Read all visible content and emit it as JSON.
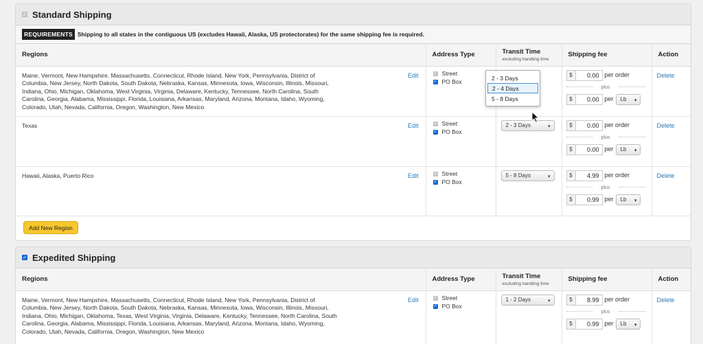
{
  "standard": {
    "title": "Standard Shipping",
    "requirements_badge": "REQUIREMENTS",
    "requirements_text": "Shipping to all states in the contiguous US (excludes Hawaii, Alaska, US protectorates) for the same shipping fee is required.",
    "add_region_label": "Add New Region",
    "rows": [
      {
        "regions": "Maine, Vermont, New Hampshire, Massachusetts, Connecticut, Rhode Island, New York, Pennsylvania, District of Columbia, New Jersey, North Dakota, South Dakota, Nebraska, Kansas, Minnesota, Iowa, Wisconsin, Illinois, Missouri, Indiana, Ohio, Michigan, Oklahoma, West Virginia, Virginia, Delaware, Kentucky, Tennessee, North Carolina, South Carolina, Georgia, Alabama, Mississippi, Florida, Louisiana, Arkansas, Maryland, Arizona, Montana, Idaho, Wyoming, Colorado, Utah, Nevada, California, Oregon, Washington, New Mexico",
        "transit": "2 - 4 Days",
        "per_order": "0.00",
        "per_unit": "0.00",
        "unit": "Lb"
      },
      {
        "regions": "Texas",
        "transit": "2 - 3 Days",
        "per_order": "0.00",
        "per_unit": "0.00",
        "unit": "Lb"
      },
      {
        "regions": "Hawaii, Alaska, Puerto Rico",
        "transit": "5 - 8 Days",
        "per_order": "4.99",
        "per_unit": "0.99",
        "unit": "Lb"
      }
    ]
  },
  "expedited": {
    "title": "Expedited Shipping",
    "rows": [
      {
        "regions": "Maine, Vermont, New Hampshire, Massachusetts, Connecticut, Rhode Island, New York, Pennsylvania, District of Columbia, New Jersey, North Dakota, South Dakota, Nebraska, Kansas, Minnesota, Iowa, Wisconsin, Illinois, Missouri, Indiana, Ohio, Michigan, Oklahoma, Texas, West Virginia, Virginia, Delaware, Kentucky, Tennessee, North Carolina, South Carolina, Georgia, Alabama, Mississippi, Florida, Louisiana, Arkansas, Maryland, Arizona, Montana, Idaho, Wyoming, Colorado, Utah, Nevada, California, Oregon, Washington, New Mexico",
        "transit": "1 - 2 Days",
        "per_order": "8.99",
        "per_unit": "0.99",
        "unit": "Lb"
      }
    ]
  },
  "columns": {
    "regions": "Regions",
    "address_type": "Address Type",
    "transit_time": "Transit Time",
    "transit_sub": "excluding handling time",
    "shipping_fee": "Shipping fee",
    "action": "Action"
  },
  "labels": {
    "edit": "Edit",
    "delete": "Delete",
    "street": "Street",
    "po_box": "PO Box",
    "dollar": "$",
    "per_order": "per order",
    "plus": "plus",
    "per": "per"
  },
  "transit_dropdown": {
    "options": [
      "2 - 3 Days",
      "2 - 4 Days",
      "5 - 8 Days"
    ],
    "selected": "2 - 4 Days"
  },
  "colors": {
    "checkbox": "#1a6fdb",
    "link": "#2a7ab8",
    "add_button": "#f7c72e"
  }
}
